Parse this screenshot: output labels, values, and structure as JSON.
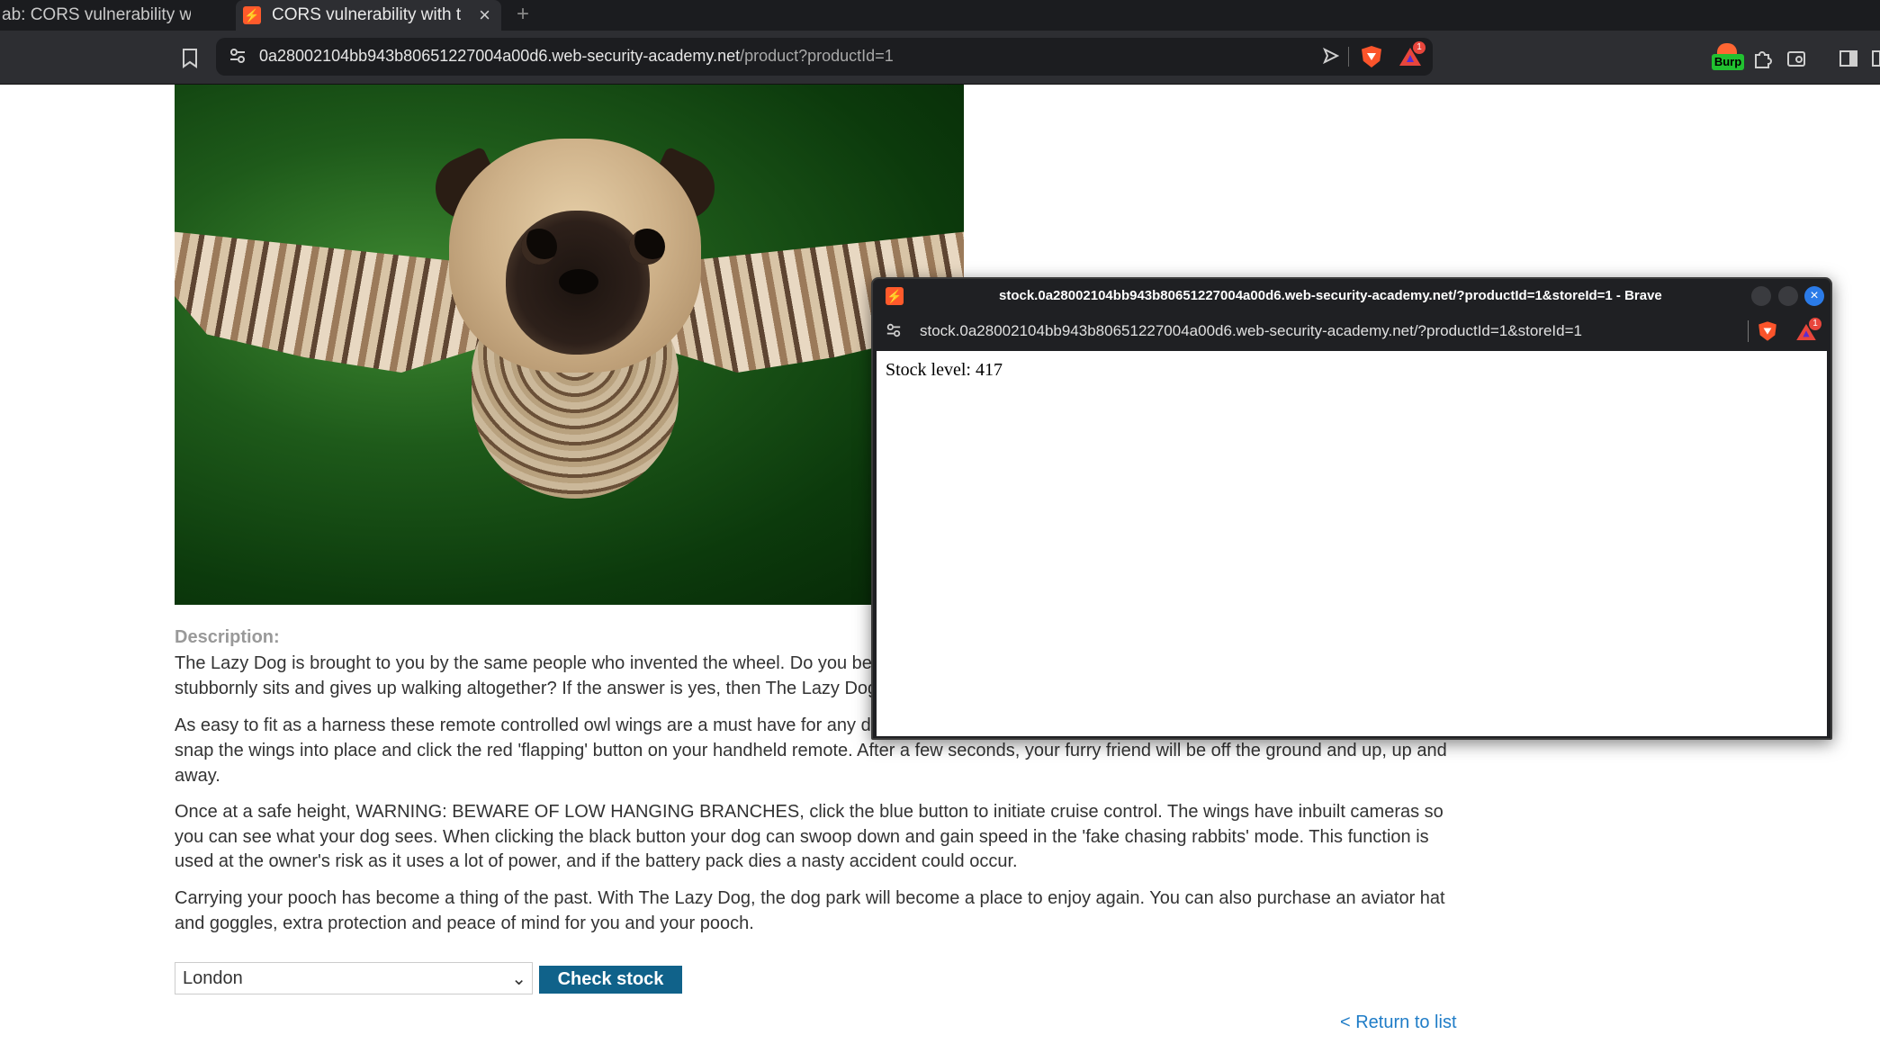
{
  "tabs": [
    {
      "label": "ab: CORS vulnerability with t",
      "active": false
    },
    {
      "label": "CORS vulnerability with tr",
      "active": true
    }
  ],
  "new_tab_symbol": "+",
  "address_bar": {
    "host": "0a28002104bb943b80651227004a00d6.web-security-academy.net",
    "path": "/product?productId=1"
  },
  "extensions": {
    "burp_label": "Burp",
    "rewards_count": "1"
  },
  "product": {
    "description_heading": "Description:",
    "paragraphs": [
      "The Lazy Dog is brought to you by the same people who invented the wheel. Do you be",
      "stubbornly sits and gives up walking altogether? If the answer is yes, then The Lazy Dog",
      "As easy to fit as a harness these remote controlled owl wings are a must have for any d",
      "snap the wings into place and click the red 'flapping' button on your handheld remote. After a few seconds, your furry friend will be off the ground and up, up and away.",
      "Once at a safe height, WARNING: BEWARE OF LOW HANGING BRANCHES, click the blue button to initiate cruise control. The wings have inbuilt cameras so you can see what your dog sees. When clicking the black button your dog can swoop down and gain speed in the 'fake chasing rabbits' mode. This function is used at the owner's risk as it uses a lot of power, and if the battery pack dies a nasty accident could occur.",
      "Carrying your pooch has become a thing of the past. With The Lazy Dog, the dog park will become a place to enjoy again. You can also purchase an aviator hat and goggles, extra protection and peace of mind for you and your pooch."
    ],
    "store_select_value": "London",
    "check_stock_label": "Check stock",
    "return_link": "< Return to list"
  },
  "popup": {
    "title": "stock.0a28002104bb943b80651227004a00d6.web-security-academy.net/?productId=1&storeId=1 - Brave",
    "url": "stock.0a28002104bb943b80651227004a00d6.web-security-academy.net/?productId=1&storeId=1",
    "body_text": "Stock level: 417",
    "rewards_count": "1"
  },
  "colors": {
    "accent_button": "#10628a",
    "link": "#1e7cc7",
    "brave_orange": "#fb542b"
  }
}
